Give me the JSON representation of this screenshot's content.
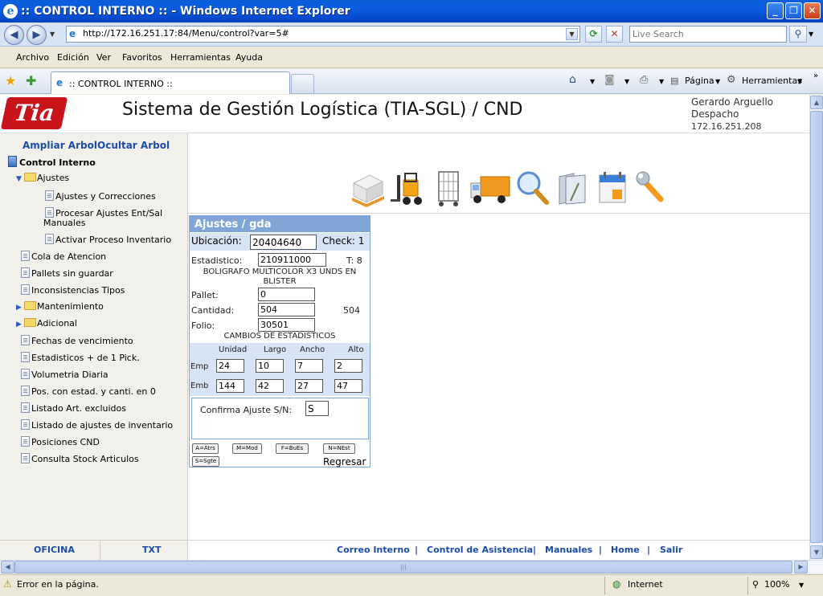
{
  "window": {
    "title": ":: CONTROL INTERNO :: - Windows Internet Explorer"
  },
  "address_bar": {
    "url": "http://172.16.251.17:84/Menu/control?var=5#",
    "search_placeholder": "Live Search"
  },
  "menu": {
    "items": [
      "Archivo",
      "Edición",
      "Ver",
      "Favoritos",
      "Herramientas",
      "Ayuda"
    ]
  },
  "tabs": {
    "active_label": ":: CONTROL INTERNO ::"
  },
  "toolbar": {
    "page_label": "Página",
    "tools_label": "Herramientas"
  },
  "header": {
    "logo_text": "Tia",
    "title": "Sistema de Gestión Logística (TIA-SGL) / CND",
    "user_name": "Gerardo Arguello",
    "user_role": "Despacho",
    "user_ip": "172.16.251.208"
  },
  "sidebar": {
    "expand_label": "Ampliar Arbol",
    "hide_label": "Ocultar Arbol",
    "root_label": "Control Interno",
    "ajustes_label": "Ajustes",
    "ajustes_children": [
      "Ajustes y Correcciones",
      "Procesar Ajustes Ent/Sal",
      "Manuales",
      "Activar Proceso Inventario"
    ],
    "items": [
      "Cola de Atencion",
      "Pallets sin guardar",
      "Inconsistencias Tipos",
      "Mantenimiento",
      "Adicional",
      "Fechas de vencimiento",
      "Estadisticos + de 1 Pick.",
      "Volumetria Diaria",
      "Pos. con estad. y canti. en 0",
      "Listado Art. excluidos",
      "Listado de ajustes de inventario",
      "Posiciones CND",
      "Consulta Stock Articulos"
    ],
    "footer_left": "OFICINA",
    "footer_right": "TXT"
  },
  "toolbar_icons": [
    "pallet-icon",
    "forklift-icon",
    "cage-cart-icon",
    "truck-icon",
    "magnifier-icon",
    "folders-icon",
    "calendar-icon",
    "wrench-icon"
  ],
  "form": {
    "title": "Ajustes / gda",
    "ubicacion_label": "Ubicación:",
    "ubicacion_value": "20404640",
    "check_label": "Check: 1",
    "estadistico_label": "Estadistico:",
    "estadistico_value": "210911000",
    "t_label": "T: 8",
    "description_line1": "BOLIGRAFO MULTICOLOR X3 UNDS EN",
    "description_line2": "BLISTER",
    "pallet_label": "Pallet:",
    "pallet_value": "0",
    "cantidad_label": "Cantidad:",
    "cantidad_value": "504",
    "cantidad_side": "504",
    "folio_label": "Folio:",
    "folio_value": "30501",
    "cambios_title": "CAMBIOS DE ESTADISTICOS",
    "col_headers": [
      "Unidad",
      "Largo",
      "Ancho",
      "Alto"
    ],
    "rows": [
      {
        "label": "Emp",
        "values": [
          "24",
          "10",
          "7",
          "2"
        ]
      },
      {
        "label": "Emb",
        "values": [
          "144",
          "42",
          "27",
          "47"
        ]
      }
    ],
    "confirm_label": "Confirma Ajuste S/N:",
    "confirm_value": "S",
    "keys": [
      "A=Atrs",
      "M=Mod",
      "F=BuEs",
      "N=NEst",
      "S=Sgte"
    ],
    "regresar_label": "Regresar"
  },
  "bottom_links": [
    "Correo Interno",
    "Control de Asistencia",
    "Manuales",
    "Home",
    "Salir"
  ],
  "status": {
    "message": "Error en la página.",
    "zone": "Internet",
    "zoom": "100%"
  }
}
